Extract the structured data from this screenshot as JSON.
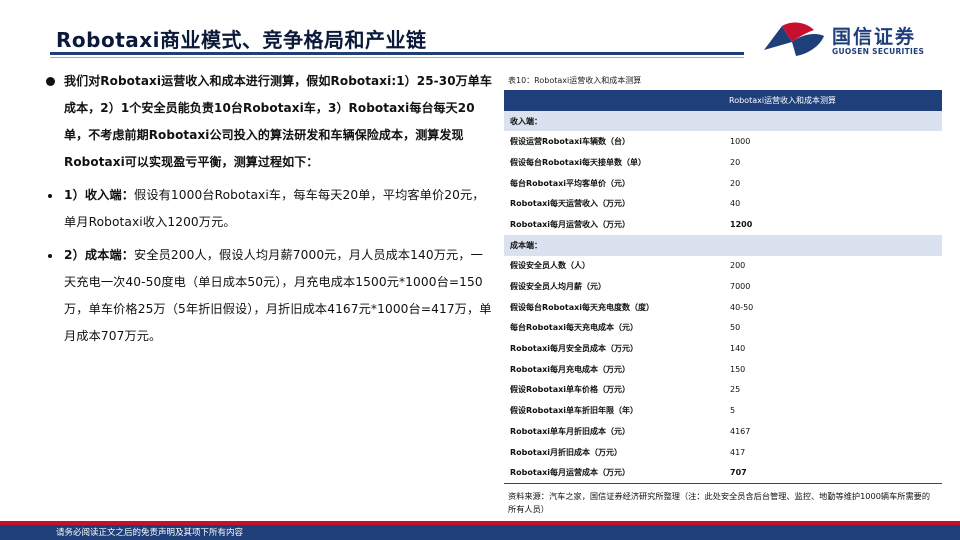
{
  "header": {
    "title": "Robotaxi商业模式、竞争格局和产业链"
  },
  "logo": {
    "cn": "国信证券",
    "en": "GUOSEN SECURITIES",
    "colors": {
      "blue": "#1f3f7a",
      "red": "#c8102e"
    }
  },
  "left": {
    "intro": "我们对Robotaxi运营收入和成本进行测算，假如Robotaxi:1）25-30万单车成本，2）1个安全员能负责10台Robotaxi车，3）Robotaxi每台每天20单，不考虑前期Robotaxi公司投入的算法研发和车辆保险成本，测算发现Robotaxi可以实现盈亏平衡，测算过程如下：",
    "revenue_head": "1）收入端：",
    "revenue_body": "假设有1000台Robotaxi车，每车每天20单，平均客单价20元，单月Robotaxi收入1200万元。",
    "cost_head": "2）成本端：",
    "cost_body": "安全员200人，假设人均月薪7000元，月人员成本140万元，一天充电一次40-50度电（单日成本50元），月充电成本1500元*1000台=150万，单车价格25万（5年折旧假设），月折旧成本4167元*1000台=417万，单月成本707万元。"
  },
  "table": {
    "caption": "表10：Robotaxi运营收入和成本测算",
    "header": "Robotaxi运营收入和成本测算",
    "section_revenue": "收入端：",
    "section_cost": "成本端：",
    "revenue_rows": [
      {
        "label": "假设运营Robotaxi车辆数（台）",
        "value": "1000"
      },
      {
        "label": "假设每台Robotaxi每天接单数（单）",
        "value": "20"
      },
      {
        "label": "每台Robotaxi平均客单价（元）",
        "value": "20"
      },
      {
        "label": "Robotaxi每天运营收入（万元）",
        "value": "40"
      },
      {
        "label": "Robotaxi每月运营收入（万元）",
        "value": "1200"
      }
    ],
    "cost_rows": [
      {
        "label": "假设安全员人数（人）",
        "value": "200"
      },
      {
        "label": "假设安全员人均月薪（元）",
        "value": "7000"
      },
      {
        "label": "假设每台Robotaxi每天充电度数（度）",
        "value": "40-50"
      },
      {
        "label": "每台Robotaxi每天充电成本（元）",
        "value": "50"
      },
      {
        "label": "Robotaxi每月安全员成本（万元）",
        "value": "140"
      },
      {
        "label": "Robotaxi每月充电成本（万元）",
        "value": "150"
      },
      {
        "label": "假设Robotaxi单车价格（万元）",
        "value": "25"
      },
      {
        "label": "假设Robotaxi单车折旧年限（年）",
        "value": "5"
      },
      {
        "label": "Robotaxi单车月折旧成本（元）",
        "value": "4167"
      },
      {
        "label": "Robotaxi月折旧成本（万元）",
        "value": "417"
      },
      {
        "label": "Robotaxi每月运营成本（万元）",
        "value": "707"
      }
    ],
    "source": "资料来源：汽车之家，国信证券经济研究所整理（注：此处安全员含后台管理、监控、地勤等维护1000辆车所需要的所有人员）"
  },
  "footer": {
    "disclaimer": "请务必阅读正文之后的免责声明及其项下所有内容"
  }
}
